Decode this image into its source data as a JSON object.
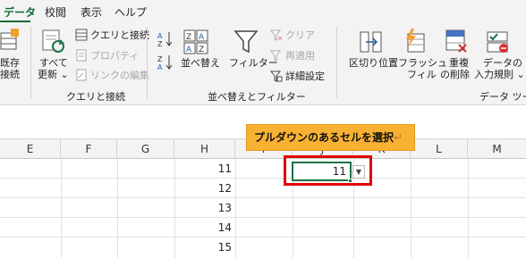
{
  "tabs": [
    {
      "label": "データ",
      "active": true
    },
    {
      "label": "校閲",
      "active": false
    },
    {
      "label": "表示",
      "active": false
    },
    {
      "label": "ヘルプ",
      "active": false
    }
  ],
  "ribbon": {
    "existing_connections": [
      "既存",
      "接続"
    ],
    "refresh_all": [
      "すべて",
      "更新 ⌄"
    ],
    "queries_connections": "クエリと接続",
    "properties": "プロパティ",
    "edit_links": "リンクの編集",
    "group_queries": "クエリと接続",
    "sort": "並べ替え",
    "filter": "フィルター",
    "clear": "クリア",
    "reapply": "再適用",
    "advanced": "詳細設定",
    "group_sort_filter": "並べ替えとフィルター",
    "text_to_columns": "区切り位置",
    "flash_fill": [
      "フラッシュ",
      "フィル"
    ],
    "remove_duplicates": [
      "重複",
      "の削除"
    ],
    "data_validation": [
      "データの",
      "入力規則 ⌄"
    ],
    "group_data_tools": "データ ツー"
  },
  "columns": [
    "E",
    "F",
    "G",
    "H",
    "I",
    "J",
    "K",
    "L",
    "M"
  ],
  "rows": [
    {
      "h_value": "11"
    },
    {
      "h_value": "12"
    },
    {
      "h_value": "13"
    },
    {
      "h_value": "14"
    },
    {
      "h_value": "15"
    }
  ],
  "callout": {
    "text": "プルダウンのあるセルを選択",
    "mark": "↵"
  },
  "selected_cell": {
    "value": "11"
  },
  "colors": {
    "accent": "#0e6b35",
    "callout": "#f8b133",
    "highlight_border": "#e00000"
  }
}
